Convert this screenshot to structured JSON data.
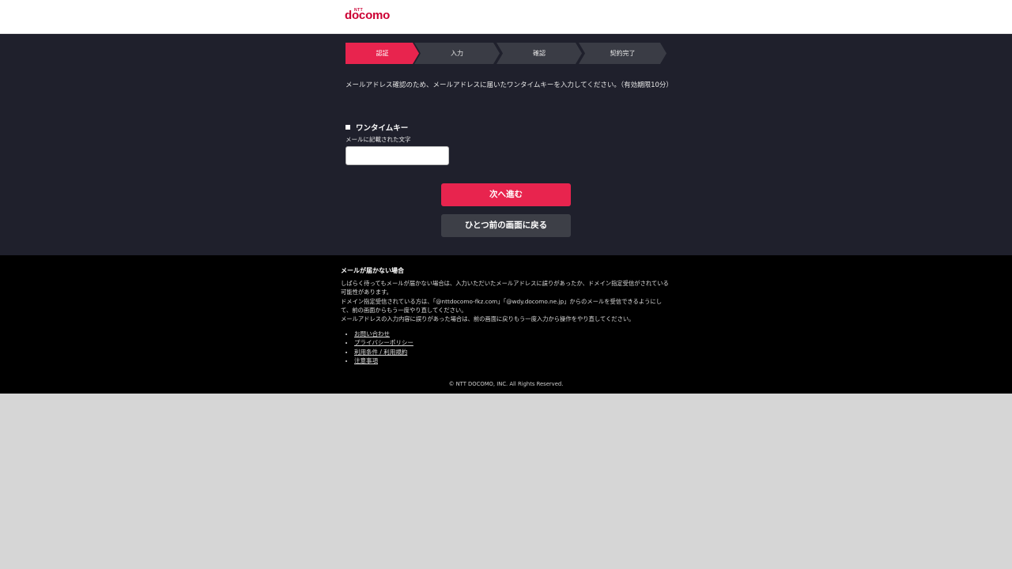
{
  "header": {
    "logo_small": "NTT",
    "logo_word": "docomo"
  },
  "steps": [
    "認証",
    "入力",
    "確認",
    "契約完了"
  ],
  "active_step": 0,
  "instruction": "メールアドレス確認のため、メールアドレスに届いたワンタイムキーを入力してください。（有効期限10分）",
  "field": {
    "title": "ワンタイムキー",
    "subtitle": "メールに記載された文字",
    "value": "",
    "placeholder": ""
  },
  "buttons": {
    "next": "次へ進む",
    "back": "ひとつ前の画面に戻る"
  },
  "footer": {
    "title": "メールが届かない場合",
    "lines": [
      "しばらく待ってもメールが届かない場合は、入力いただいたメールアドレスに誤りがあったか、ドメイン指定受信がされている可能性があります。",
      "ドメイン指定受信されている方は、「@nttdocomo-fkz.com」「@wdy.docomo.ne.jp」からのメールを受信できるようにして、前の画面からもう一度やり直してください。",
      "メールアドレスの入力内容に誤りがあった場合は、前の画面に戻りもう一度入力から操作をやり直してください。"
    ],
    "links": [
      "お問い合わせ",
      "プライバシーポリシー",
      "利用条件 / 利用規約",
      "注意事項"
    ],
    "copyright": "© NTT DOCOMO, INC. All Rights Reserved."
  },
  "colors": {
    "brand": "#cc0033",
    "accent": "#e8244e",
    "main_bg": "#1f202c",
    "step_bg": "#3a3c45",
    "footer_bg": "#000000"
  }
}
